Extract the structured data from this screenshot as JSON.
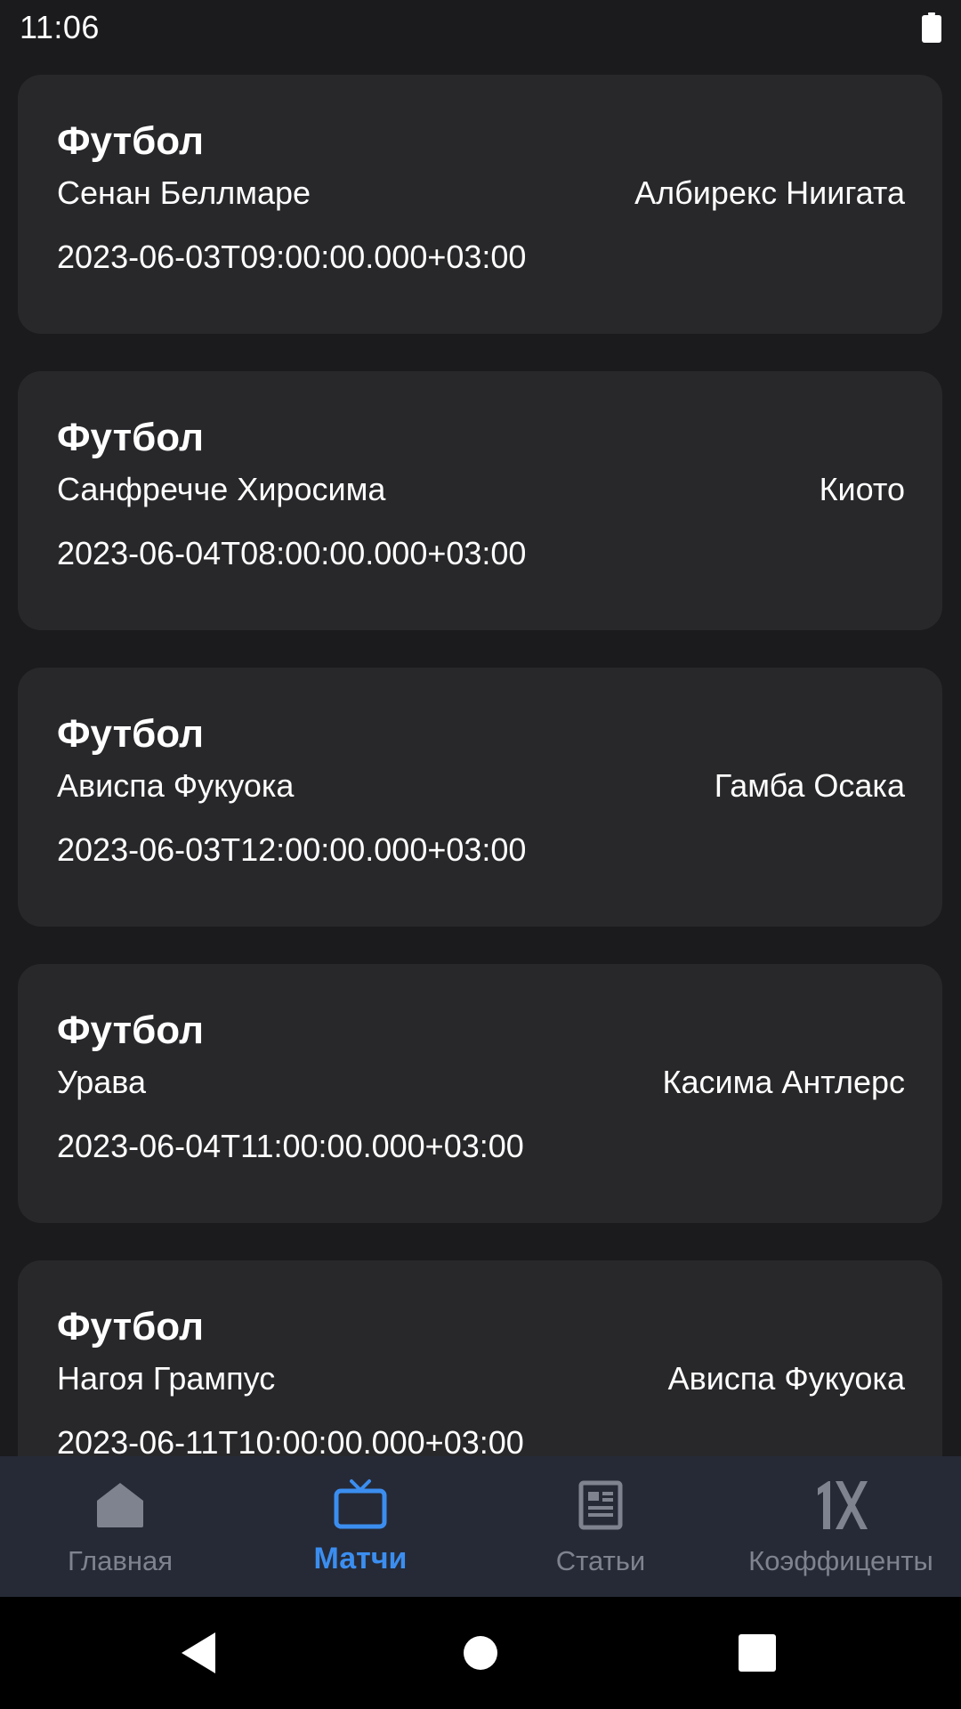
{
  "status_bar": {
    "time": "11:06",
    "battery_icon": "battery-full-icon"
  },
  "matches": [
    {
      "sport": "Футбол",
      "home_team": "Сенан Беллмаре",
      "away_team": "Албирекс Ниигата",
      "datetime": "2023-06-03T09:00:00.000+03:00"
    },
    {
      "sport": "Футбол",
      "home_team": "Санфречче Хиросима",
      "away_team": "Киото",
      "datetime": "2023-06-04T08:00:00.000+03:00"
    },
    {
      "sport": "Футбол",
      "home_team": "Ависпа Фукуока",
      "away_team": "Гамба Осака",
      "datetime": "2023-06-03T12:00:00.000+03:00"
    },
    {
      "sport": "Футбол",
      "home_team": "Урава",
      "away_team": "Касима Антлерс",
      "datetime": "2023-06-04T11:00:00.000+03:00"
    },
    {
      "sport": "Футбол",
      "home_team": "Нагоя Грампус",
      "away_team": "Ависпа Фукуока",
      "datetime": "2023-06-11T10:00:00.000+03:00"
    }
  ],
  "bottom_nav": {
    "active_color": "#3b8ef0",
    "inactive_color": "#7f8390",
    "items": [
      {
        "label": "Главная",
        "icon": "home-icon",
        "active": false
      },
      {
        "label": "Матчи",
        "icon": "tv-icon",
        "active": true
      },
      {
        "label": "Статьи",
        "icon": "article-icon",
        "active": false
      },
      {
        "label": "Коэффиценты",
        "icon": "1x-logo-icon",
        "active": false
      }
    ]
  },
  "system_nav": {
    "back_icon": "back-triangle-icon",
    "home_icon": "home-circle-icon",
    "recents_icon": "recents-square-icon"
  }
}
